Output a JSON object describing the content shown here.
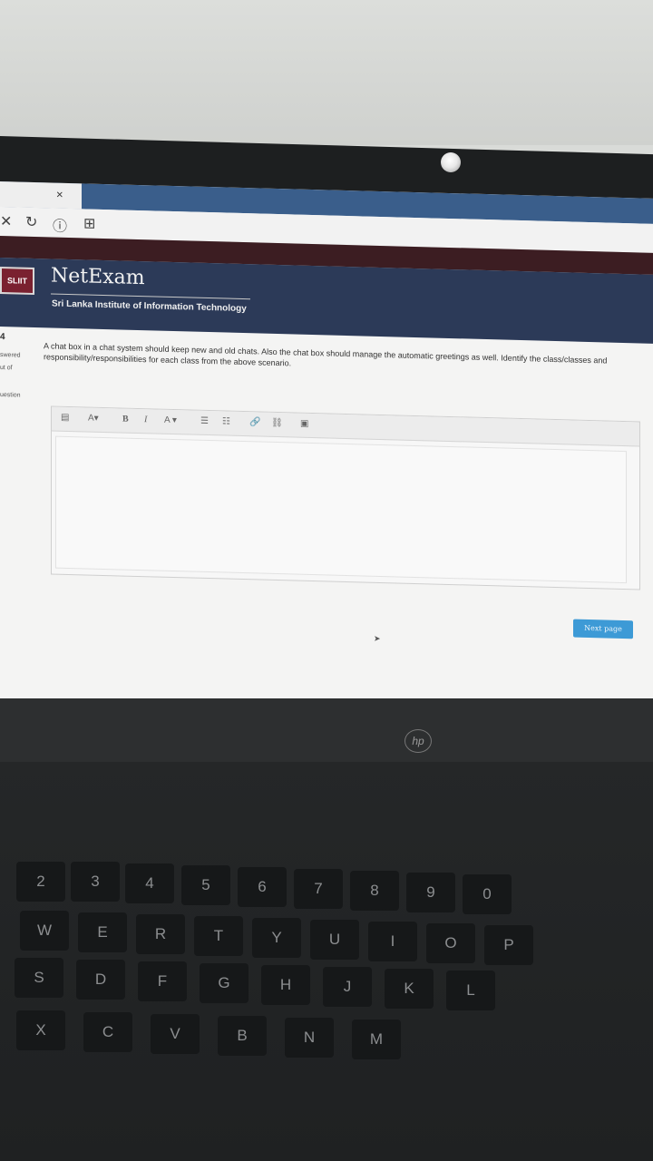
{
  "browser": {
    "tab_close": "×",
    "nav_icons": [
      "✕",
      "↻",
      "ⓘ",
      "⊞"
    ]
  },
  "header": {
    "logo": "SLIIT",
    "brand": "NetExam",
    "institute": "Sri Lanka Institute of Information Technology"
  },
  "side_info": {
    "number": "4",
    "line1": "swered",
    "line2": "ut of",
    "line3": "uestion"
  },
  "question": {
    "text": "A chat box in a chat system should keep new and old chats. Also the chat box should manage the automatic greetings as well. Identify the class/classes and responsibility/responsibilities for each class from the above scenario."
  },
  "toolbar": {
    "buttons": [
      "▤",
      "A▾",
      "B",
      "I",
      "A ▾",
      "☰",
      "☷",
      "🔗",
      "⛓",
      "▣"
    ]
  },
  "answer": {
    "value": ""
  },
  "next_button": {
    "label": "Next page"
  },
  "laptop": {
    "logo": "hp",
    "keys_row1": [
      "2",
      "3",
      "4",
      "5",
      "6",
      "7",
      "8",
      "9",
      "0"
    ],
    "keys_row2": [
      "W",
      "E",
      "R",
      "T",
      "Y",
      "U",
      "I",
      "O",
      "P"
    ],
    "keys_row3": [
      "S",
      "D",
      "F",
      "G",
      "H",
      "J",
      "K",
      "L"
    ],
    "keys_row4": [
      "X",
      "C",
      "V",
      "B",
      "N",
      "M"
    ]
  }
}
